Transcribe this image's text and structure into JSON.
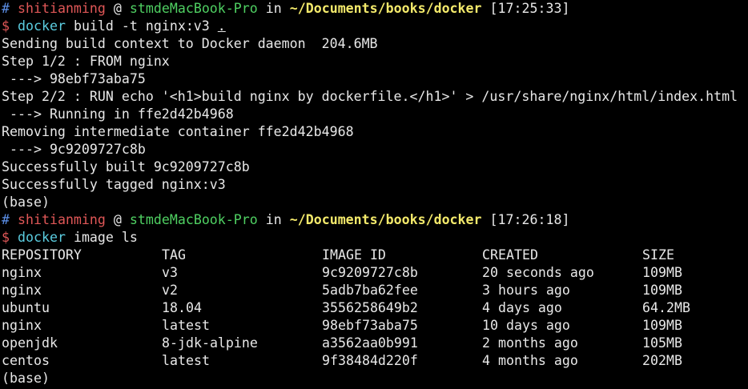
{
  "prompt1": {
    "hash": "#",
    "user": "shitianming",
    "at": "@",
    "host": "stmdeMacBook-Pro",
    "in": "in",
    "path": "~/Documents/books/docker",
    "time": "[17:25:33]"
  },
  "command1": {
    "dollar": "$",
    "cmd": "docker",
    "args": "build -t nginx:v3",
    "context": "."
  },
  "build_output": [
    "Sending build context to Docker daemon  204.6MB",
    "Step 1/2 : FROM nginx",
    " ---> 98ebf73aba75",
    "Step 2/2 : RUN echo '<h1>build nginx by dockerfile.</h1>' > /usr/share/nginx/html/index.html",
    " ---> Running in ffe2d42b4968",
    "Removing intermediate container ffe2d42b4968",
    " ---> 9c9209727c8b",
    "Successfully built 9c9209727c8b",
    "Successfully tagged nginx:v3",
    "(base)"
  ],
  "prompt2": {
    "hash": "#",
    "user": "shitianming",
    "at": "@",
    "host": "stmdeMacBook-Pro",
    "in": "in",
    "path": "~/Documents/books/docker",
    "time": "[17:26:18]"
  },
  "command2": {
    "dollar": "$",
    "cmd": "docker",
    "args": "image ls"
  },
  "images_table": {
    "headers": [
      "REPOSITORY",
      "TAG",
      "IMAGE ID",
      "CREATED",
      "SIZE"
    ],
    "rows": [
      [
        "nginx",
        "v3",
        "9c9209727c8b",
        "20 seconds ago",
        "109MB"
      ],
      [
        "nginx",
        "v2",
        "5adb7ba62fee",
        "3 hours ago",
        "109MB"
      ],
      [
        "ubuntu",
        "18.04",
        "3556258649b2",
        "4 days ago",
        "64.2MB"
      ],
      [
        "nginx",
        "latest",
        "98ebf73aba75",
        "10 days ago",
        "109MB"
      ],
      [
        "openjdk",
        "8-jdk-alpine",
        "a3562aa0b991",
        "2 months ago",
        "105MB"
      ],
      [
        "centos",
        "latest",
        "9f38484d220f",
        "4 months ago",
        "202MB"
      ]
    ]
  },
  "final_line": "(base)"
}
